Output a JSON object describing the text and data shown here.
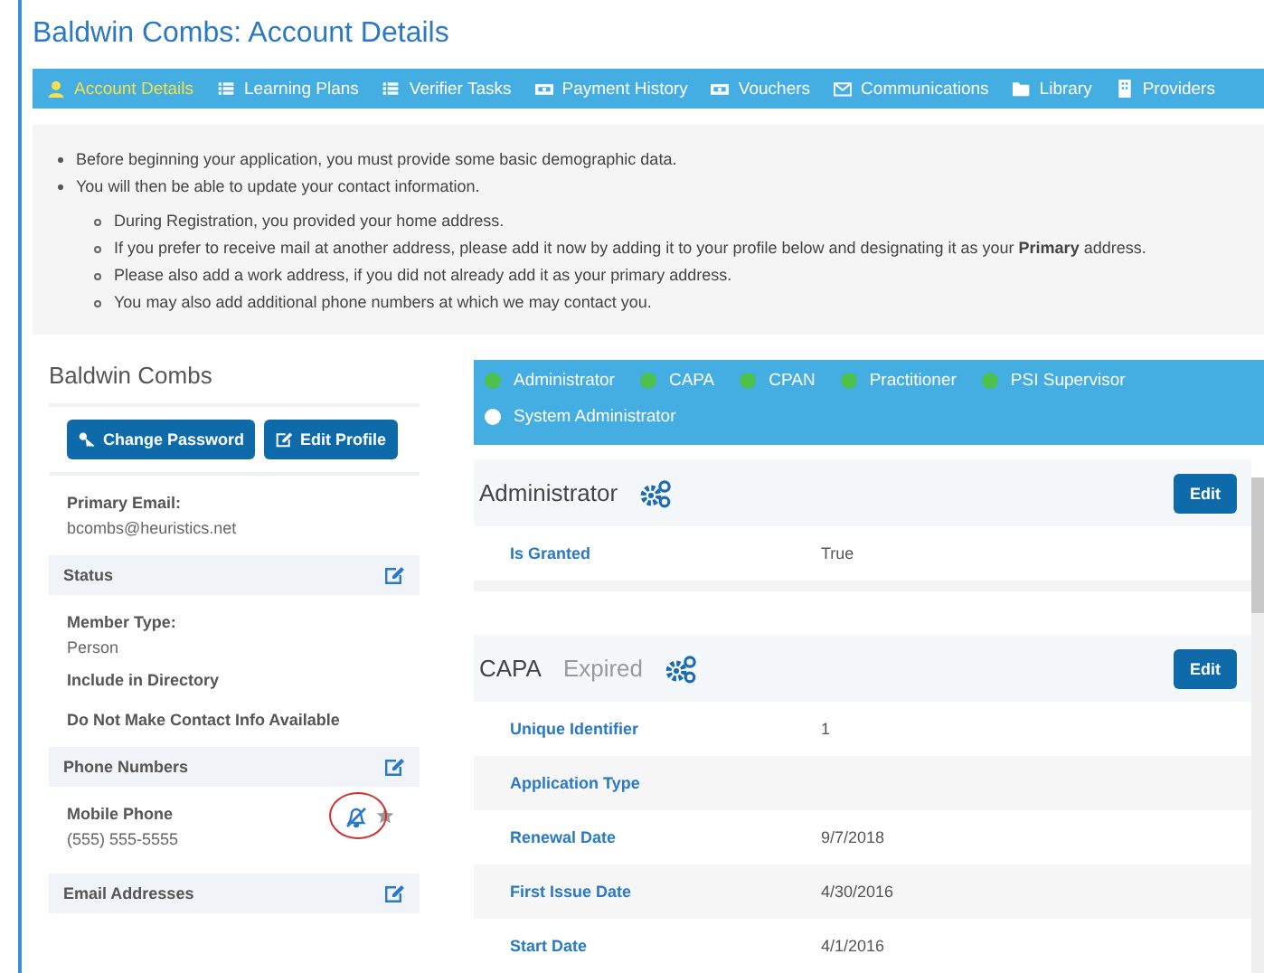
{
  "page_title": "Baldwin Combs: Account Details",
  "tabs": [
    {
      "label": "Account Details",
      "kind": "user",
      "selected": true
    },
    {
      "label": "Learning Plans",
      "kind": "list",
      "selected": false
    },
    {
      "label": "Verifier Tasks",
      "kind": "list",
      "selected": false
    },
    {
      "label": "Payment History",
      "kind": "money",
      "selected": false
    },
    {
      "label": "Vouchers",
      "kind": "money",
      "selected": false
    },
    {
      "label": "Communications",
      "kind": "mail",
      "selected": false
    },
    {
      "label": "Library",
      "kind": "folder",
      "selected": false
    },
    {
      "label": "Providers",
      "kind": "building",
      "selected": false
    }
  ],
  "notice": {
    "items": [
      "Before beginning your application, you must provide some basic demographic data.",
      "You will then be able to update your contact information."
    ],
    "subitems": [
      "During Registration, you provided your home address.",
      "If you prefer to receive mail at another address, please add it now by adding it to your profile below and designating it as your **Primary** address.",
      "Please also add a work address, if you did not already add it as your primary address.",
      "You may also add additional phone numbers at which we may contact you."
    ]
  },
  "profile": {
    "name": "Baldwin Combs",
    "buttons": [
      {
        "label": "Change Password",
        "kind": "key"
      },
      {
        "label": "Edit Profile",
        "kind": "edit"
      }
    ],
    "primary_email_label": "Primary Email:",
    "primary_email": "bcombs@heuristics.net",
    "sections": [
      {
        "title": "Status",
        "fields": [
          {
            "label": "Member Type:",
            "value": "Person"
          },
          {
            "label": "Include in Directory"
          },
          {
            "label": "Do Not Make Contact Info Available"
          }
        ]
      },
      {
        "title": "Phone Numbers",
        "phones": [
          {
            "label": "Mobile Phone",
            "value": "(555) 555-5555",
            "notifications_muted": true,
            "annotated": true
          }
        ]
      },
      {
        "title": "Email Addresses"
      }
    ]
  },
  "roles": [
    {
      "label": "Administrator",
      "granted": true
    },
    {
      "label": "CAPA",
      "granted": true
    },
    {
      "label": "CPAN",
      "granted": true
    },
    {
      "label": "Practitioner",
      "granted": true
    },
    {
      "label": "PSI Supervisor",
      "granted": true
    },
    {
      "label": "System Administrator",
      "granted": false
    }
  ],
  "role_panels": [
    {
      "title": "Administrator",
      "button": "Edit",
      "rows": [
        {
          "label": "Is Granted",
          "value": "True"
        }
      ]
    },
    {
      "title": "CAPA",
      "status": "Expired",
      "button": "Edit",
      "rows": [
        {
          "label": "Unique Identifier",
          "value": "1"
        },
        {
          "label": "Application Type"
        },
        {
          "label": "Renewal Date",
          "value": "9/7/2018"
        },
        {
          "label": "First Issue Date",
          "value": "4/30/2016"
        },
        {
          "label": "Start Date",
          "value": "4/1/2016"
        }
      ]
    }
  ]
}
